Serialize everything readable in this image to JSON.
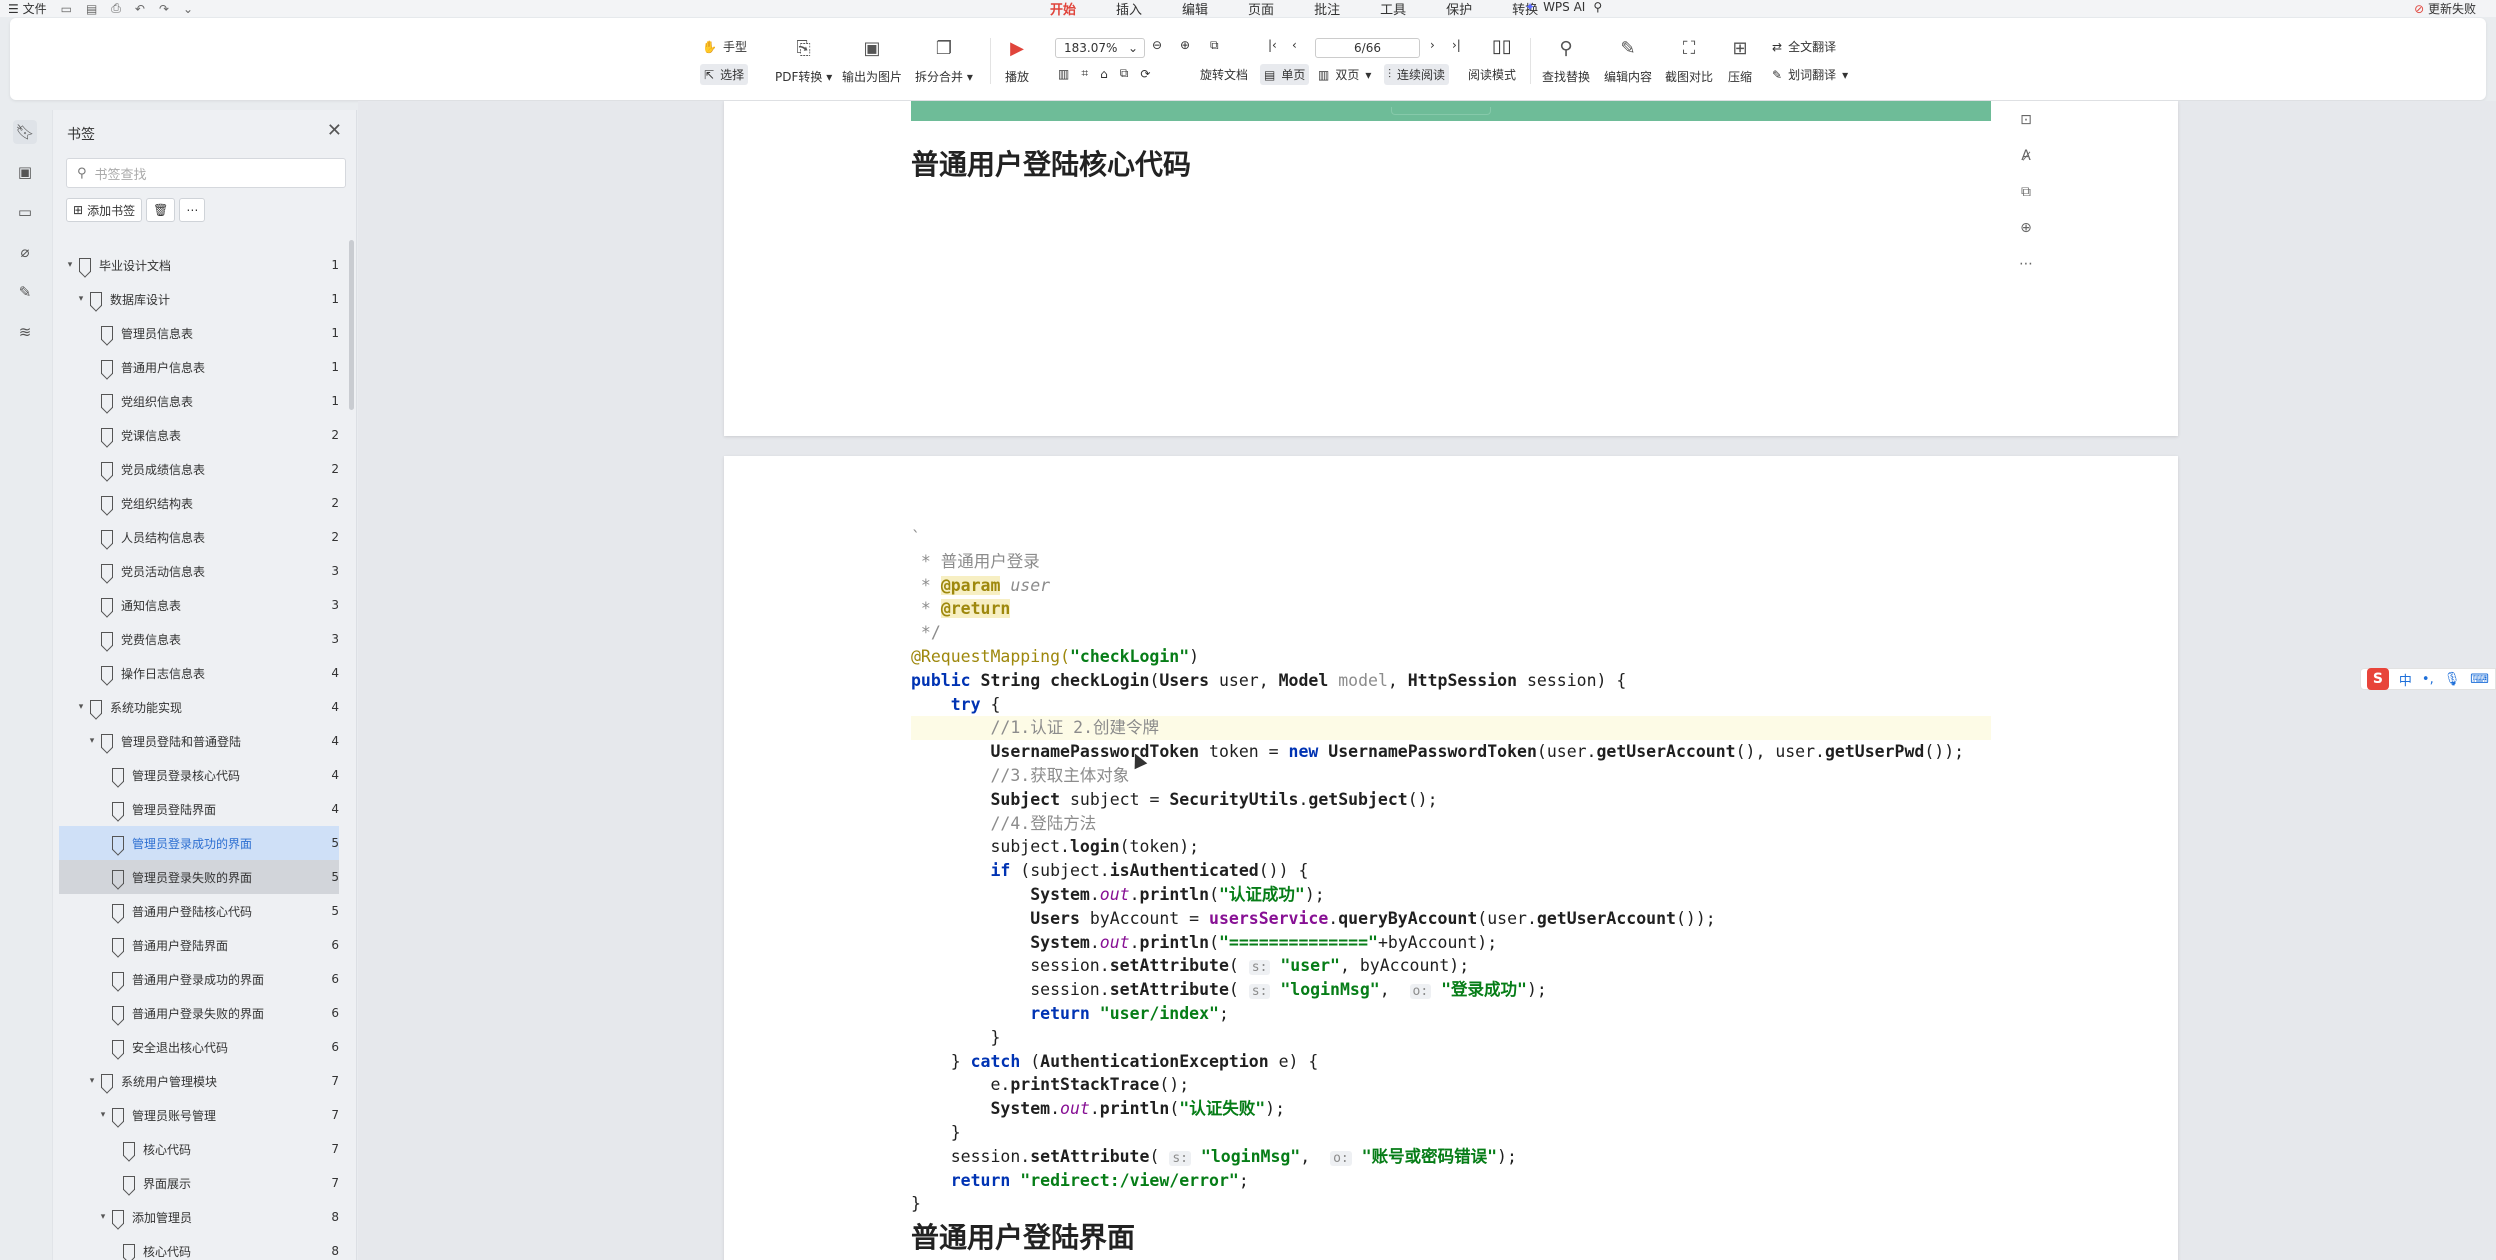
{
  "topbar": {
    "file_menu": "文件",
    "tabs": [
      "开始",
      "插入",
      "编辑",
      "页面",
      "批注",
      "工具",
      "保护",
      "转换"
    ],
    "active_tab": "开始",
    "wps_ai": "WPS AI",
    "update_label": "更新失败"
  },
  "ribbon": {
    "hand_tool": "手型",
    "select_tool": "选择",
    "pdf_convert": "PDF转换",
    "export_image": "输出为图片",
    "split_merge": "拆分合并",
    "play": "播放",
    "zoom": "183.07%",
    "page": "6/66",
    "rotate_doc": "旋转文档",
    "single_page": "单页",
    "double_page": "双页",
    "continuous": "连续阅读",
    "read_mode": "阅读模式",
    "find_replace": "查找替换",
    "edit_content": "编辑内容",
    "screenshot_compare": "截图对比",
    "compress": "压缩",
    "full_translate": "全文翻译",
    "word_translate": "划词翻译"
  },
  "bookmarks": {
    "title": "书签",
    "search_placeholder": "书签查找",
    "add_label": "添加书签",
    "items": [
      {
        "label": "毕业设计文档",
        "page": "1",
        "level": 0,
        "expand": true
      },
      {
        "label": "数据库设计",
        "page": "1",
        "level": 1,
        "expand": true
      },
      {
        "label": "管理员信息表",
        "page": "1",
        "level": 2
      },
      {
        "label": "普通用户信息表",
        "page": "1",
        "level": 2
      },
      {
        "label": "党组织信息表",
        "page": "1",
        "level": 2
      },
      {
        "label": "党课信息表",
        "page": "2",
        "level": 2
      },
      {
        "label": "党员成绩信息表",
        "page": "2",
        "level": 2
      },
      {
        "label": "党组织结构表",
        "page": "2",
        "level": 2
      },
      {
        "label": "人员结构信息表",
        "page": "2",
        "level": 2
      },
      {
        "label": "党员活动信息表",
        "page": "3",
        "level": 2
      },
      {
        "label": "通知信息表",
        "page": "3",
        "level": 2
      },
      {
        "label": "党费信息表",
        "page": "3",
        "level": 2
      },
      {
        "label": "操作日志信息表",
        "page": "4",
        "level": 2
      },
      {
        "label": "系统功能实现",
        "page": "4",
        "level": 1,
        "expand": true
      },
      {
        "label": "管理员登陆和普通登陆",
        "page": "4",
        "level": 2,
        "expand": true
      },
      {
        "label": "管理员登录核心代码",
        "page": "4",
        "level": 3
      },
      {
        "label": "管理员登陆界面",
        "page": "4",
        "level": 3
      },
      {
        "label": "管理员登录成功的界面",
        "page": "5",
        "level": 3,
        "state": "blue"
      },
      {
        "label": "管理员登录失败的界面",
        "page": "5",
        "level": 3,
        "state": "gray"
      },
      {
        "label": "普通用户登陆核心代码",
        "page": "5",
        "level": 3
      },
      {
        "label": "普通用户登陆界面",
        "page": "6",
        "level": 3
      },
      {
        "label": "普通用户登录成功的界面",
        "page": "6",
        "level": 3
      },
      {
        "label": "普通用户登录失败的界面",
        "page": "6",
        "level": 3
      },
      {
        "label": "安全退出核心代码",
        "page": "6",
        "level": 3
      },
      {
        "label": "系统用户管理模块",
        "page": "7",
        "level": 2,
        "expand": true
      },
      {
        "label": "管理员账号管理",
        "page": "7",
        "level": 3,
        "expand": true
      },
      {
        "label": "核心代码",
        "page": "7",
        "level": 4
      },
      {
        "label": "界面展示",
        "page": "7",
        "level": 4
      },
      {
        "label": "添加管理员",
        "page": "8",
        "level": 3,
        "expand": true
      },
      {
        "label": "核心代码",
        "page": "8",
        "level": 4
      }
    ]
  },
  "document": {
    "heading_core": "普通用户登陆核心代码",
    "heading_ui": "普通用户登陆界面",
    "code_lines": [
      {
        "parts": [
          {
            "t": "`",
            "c": "c-com"
          }
        ]
      },
      {
        "parts": [
          {
            "t": " * 普通用户登录",
            "c": "c-com"
          }
        ]
      },
      {
        "parts": [
          {
            "t": " * ",
            "c": "c-com"
          },
          {
            "t": "@param",
            "c": "c-tag"
          },
          {
            "t": " ",
            "c": ""
          },
          {
            "t": "user",
            "c": "c-par"
          }
        ]
      },
      {
        "parts": [
          {
            "t": " * ",
            "c": "c-com"
          },
          {
            "t": "@return",
            "c": "c-tag"
          }
        ]
      },
      {
        "parts": [
          {
            "t": " */",
            "c": "c-com"
          }
        ]
      },
      {
        "parts": [
          {
            "t": "@RequestMapping(",
            "c": "c-ann"
          },
          {
            "t": "\"checkLogin\"",
            "c": "c-str"
          },
          {
            "t": ")",
            "c": ""
          }
        ]
      },
      {
        "parts": [
          {
            "t": "public ",
            "c": "c-kw"
          },
          {
            "t": "String ",
            "c": "c-fn"
          },
          {
            "t": "checkLogin",
            "c": "c-fn"
          },
          {
            "t": "(",
            "c": ""
          },
          {
            "t": "Users ",
            "c": "c-fn"
          },
          {
            "t": "user, ",
            "c": ""
          },
          {
            "t": "Model ",
            "c": "c-fn"
          },
          {
            "t": "model",
            "c": "c-com"
          },
          {
            "t": ", ",
            "c": ""
          },
          {
            "t": "HttpSession ",
            "c": "c-fn"
          },
          {
            "t": "session) {",
            "c": ""
          }
        ]
      },
      {
        "parts": [
          {
            "t": "    ",
            "c": ""
          },
          {
            "t": "try ",
            "c": "c-kw"
          },
          {
            "t": "{",
            "c": ""
          }
        ]
      },
      {
        "hl": true,
        "parts": [
          {
            "t": "        //1.认证 2.创建令牌",
            "c": "c-com"
          }
        ]
      },
      {
        "parts": [
          {
            "t": "        ",
            "c": ""
          },
          {
            "t": "UsernamePasswordToken ",
            "c": "c-fn"
          },
          {
            "t": "token = ",
            "c": ""
          },
          {
            "t": "new ",
            "c": "c-kw"
          },
          {
            "t": "UsernamePasswordToken",
            "c": "c-fn"
          },
          {
            "t": "(user.",
            "c": ""
          },
          {
            "t": "getUserAccount",
            "c": "c-fn"
          },
          {
            "t": "(), user.",
            "c": ""
          },
          {
            "t": "getUserPwd",
            "c": "c-fn"
          },
          {
            "t": "());",
            "c": ""
          }
        ]
      },
      {
        "parts": [
          {
            "t": "        //3.获取主体对象",
            "c": "c-com"
          }
        ]
      },
      {
        "parts": [
          {
            "t": "        ",
            "c": ""
          },
          {
            "t": "Subject ",
            "c": "c-fn"
          },
          {
            "t": "subject = ",
            "c": ""
          },
          {
            "t": "SecurityUtils",
            "c": "c-fn"
          },
          {
            "t": ".",
            "c": ""
          },
          {
            "t": "getSubject",
            "c": "c-fn"
          },
          {
            "t": "();",
            "c": ""
          }
        ]
      },
      {
        "parts": [
          {
            "t": "        //4.登陆方法",
            "c": "c-com"
          }
        ]
      },
      {
        "parts": [
          {
            "t": "        subject.",
            "c": ""
          },
          {
            "t": "login",
            "c": "c-fn"
          },
          {
            "t": "(token);",
            "c": ""
          }
        ]
      },
      {
        "parts": [
          {
            "t": "        ",
            "c": ""
          },
          {
            "t": "if ",
            "c": "c-kw"
          },
          {
            "t": "(subject.",
            "c": ""
          },
          {
            "t": "isAuthenticated",
            "c": "c-fn"
          },
          {
            "t": "()) {",
            "c": ""
          }
        ]
      },
      {
        "parts": [
          {
            "t": "            ",
            "c": ""
          },
          {
            "t": "System",
            "c": "c-fn"
          },
          {
            "t": ".",
            "c": ""
          },
          {
            "t": "out",
            "c": "c-it"
          },
          {
            "t": ".",
            "c": ""
          },
          {
            "t": "println",
            "c": "c-fn"
          },
          {
            "t": "(",
            "c": ""
          },
          {
            "t": "\"认证成功\"",
            "c": "c-str"
          },
          {
            "t": ");",
            "c": ""
          }
        ]
      },
      {
        "parts": [
          {
            "t": "            ",
            "c": ""
          },
          {
            "t": "Users ",
            "c": "c-fn"
          },
          {
            "t": "byAccount = ",
            "c": ""
          },
          {
            "t": "usersService",
            "c": "c-svc"
          },
          {
            "t": ".",
            "c": ""
          },
          {
            "t": "queryByAccount",
            "c": "c-fn"
          },
          {
            "t": "(user.",
            "c": ""
          },
          {
            "t": "getUserAccount",
            "c": "c-fn"
          },
          {
            "t": "());",
            "c": ""
          }
        ]
      },
      {
        "parts": [
          {
            "t": "            ",
            "c": ""
          },
          {
            "t": "System",
            "c": "c-fn"
          },
          {
            "t": ".",
            "c": ""
          },
          {
            "t": "out",
            "c": "c-it"
          },
          {
            "t": ".",
            "c": ""
          },
          {
            "t": "println",
            "c": "c-fn"
          },
          {
            "t": "(",
            "c": ""
          },
          {
            "t": "\"==============\"",
            "c": "c-str"
          },
          {
            "t": "+byAccount);",
            "c": ""
          }
        ]
      },
      {
        "parts": [
          {
            "t": "            session.",
            "c": ""
          },
          {
            "t": "setAttribute",
            "c": "c-fn"
          },
          {
            "t": "( ",
            "c": ""
          },
          {
            "t": "s:",
            "c": "c-hint"
          },
          {
            "t": " ",
            "c": ""
          },
          {
            "t": "\"user\"",
            "c": "c-str"
          },
          {
            "t": ", byAccount);",
            "c": ""
          }
        ]
      },
      {
        "parts": [
          {
            "t": "            session.",
            "c": ""
          },
          {
            "t": "setAttribute",
            "c": "c-fn"
          },
          {
            "t": "( ",
            "c": ""
          },
          {
            "t": "s:",
            "c": "c-hint"
          },
          {
            "t": " ",
            "c": ""
          },
          {
            "t": "\"loginMsg\"",
            "c": "c-str"
          },
          {
            "t": ",  ",
            "c": ""
          },
          {
            "t": "o:",
            "c": "c-hint"
          },
          {
            "t": " ",
            "c": ""
          },
          {
            "t": "\"登录成功\"",
            "c": "c-str"
          },
          {
            "t": ");",
            "c": ""
          }
        ]
      },
      {
        "parts": [
          {
            "t": "            ",
            "c": ""
          },
          {
            "t": "return ",
            "c": "c-kw"
          },
          {
            "t": "\"user/index\"",
            "c": "c-str"
          },
          {
            "t": ";",
            "c": ""
          }
        ]
      },
      {
        "parts": [
          {
            "t": "        }",
            "c": ""
          }
        ]
      },
      {
        "parts": [
          {
            "t": "    } ",
            "c": ""
          },
          {
            "t": "catch ",
            "c": "c-kw"
          },
          {
            "t": "(",
            "c": ""
          },
          {
            "t": "AuthenticationException ",
            "c": "c-fn"
          },
          {
            "t": "e) {",
            "c": ""
          }
        ]
      },
      {
        "parts": [
          {
            "t": "        e.",
            "c": ""
          },
          {
            "t": "printStackTrace",
            "c": "c-fn"
          },
          {
            "t": "();",
            "c": ""
          }
        ]
      },
      {
        "parts": [
          {
            "t": "        ",
            "c": ""
          },
          {
            "t": "System",
            "c": "c-fn"
          },
          {
            "t": ".",
            "c": ""
          },
          {
            "t": "out",
            "c": "c-it"
          },
          {
            "t": ".",
            "c": ""
          },
          {
            "t": "println",
            "c": "c-fn"
          },
          {
            "t": "(",
            "c": ""
          },
          {
            "t": "\"认证失败\"",
            "c": "c-str"
          },
          {
            "t": ");",
            "c": ""
          }
        ]
      },
      {
        "parts": [
          {
            "t": "    }",
            "c": ""
          }
        ]
      },
      {
        "parts": [
          {
            "t": "    session.",
            "c": ""
          },
          {
            "t": "setAttribute",
            "c": "c-fn"
          },
          {
            "t": "( ",
            "c": ""
          },
          {
            "t": "s:",
            "c": "c-hint"
          },
          {
            "t": " ",
            "c": ""
          },
          {
            "t": "\"loginMsg\"",
            "c": "c-str"
          },
          {
            "t": ",  ",
            "c": ""
          },
          {
            "t": "o:",
            "c": "c-hint"
          },
          {
            "t": " ",
            "c": ""
          },
          {
            "t": "\"账号或密码错误\"",
            "c": "c-str"
          },
          {
            "t": ");",
            "c": ""
          }
        ]
      },
      {
        "parts": [
          {
            "t": "    ",
            "c": ""
          },
          {
            "t": "return ",
            "c": "c-kw"
          },
          {
            "t": "\"redirect:/view/error\"",
            "c": "c-str"
          },
          {
            "t": ";",
            "c": ""
          }
        ]
      },
      {
        "parts": [
          {
            "t": "}",
            "c": ""
          }
        ]
      }
    ]
  },
  "ime": {
    "label": "中"
  },
  "colors": {
    "accent": "#e0443b",
    "selected_bookmark": "#cfe0f7",
    "code_header_band": "#6ebc98"
  }
}
